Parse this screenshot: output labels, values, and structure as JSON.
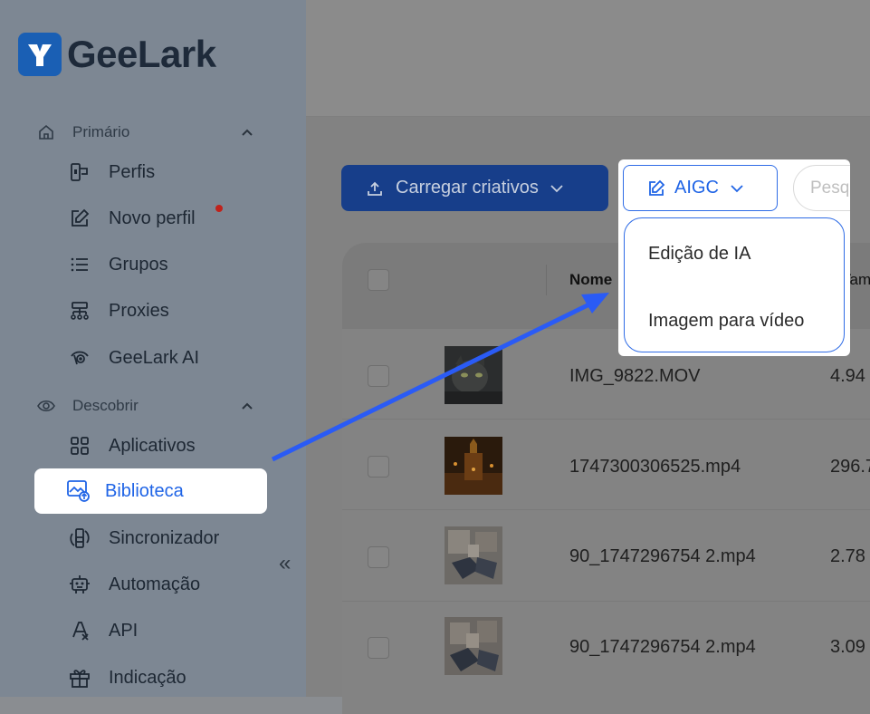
{
  "brand": {
    "name": "GeeLark"
  },
  "sidebar": {
    "sections": [
      {
        "label": "Primário"
      },
      {
        "label": "Descobrir"
      }
    ],
    "primary_items": [
      {
        "label": "Perfis",
        "icon": "profiles-icon"
      },
      {
        "label": "Novo perfil",
        "icon": "edit-icon"
      },
      {
        "label": "Grupos",
        "icon": "list-icon"
      },
      {
        "label": "Proxies",
        "icon": "proxy-network-icon"
      },
      {
        "label": "GeeLark AI",
        "icon": "eye-ai-icon"
      }
    ],
    "discover_items": [
      {
        "label": "Aplicativos",
        "icon": "apps-grid-icon"
      },
      {
        "label": "Biblioteca",
        "icon": "library-image-icon"
      },
      {
        "label": "Sincronizador",
        "icon": "sync-devices-icon"
      },
      {
        "label": "Automação",
        "icon": "robot-icon"
      },
      {
        "label": "API",
        "icon": "api-icon"
      },
      {
        "label": "Indicação",
        "icon": "gift-icon"
      }
    ],
    "collapse_label": "«"
  },
  "toolbar": {
    "upload_label": "Carregar criativos",
    "aigc_label": "AIGC",
    "search_placeholder": "Pesquisar"
  },
  "aigc_menu": {
    "items": [
      {
        "label": "Edição de IA"
      },
      {
        "label": "Imagem para vídeo"
      }
    ]
  },
  "table": {
    "columns": {
      "name": "Nome",
      "size": "Tamanho"
    },
    "rows": [
      {
        "name": "IMG_9822.MOV",
        "size": "4.94"
      },
      {
        "name": "1747300306525.mp4",
        "size": "296.7"
      },
      {
        "name": "90_1747296754 2.mp4",
        "size": "2.78"
      },
      {
        "name": "90_1747296754 2.mp4",
        "size": "3.09"
      }
    ]
  },
  "colors": {
    "accent": "#1f64e6",
    "annotation_arrow": "#2a5bf5",
    "notification_dot": "#c0221b"
  }
}
